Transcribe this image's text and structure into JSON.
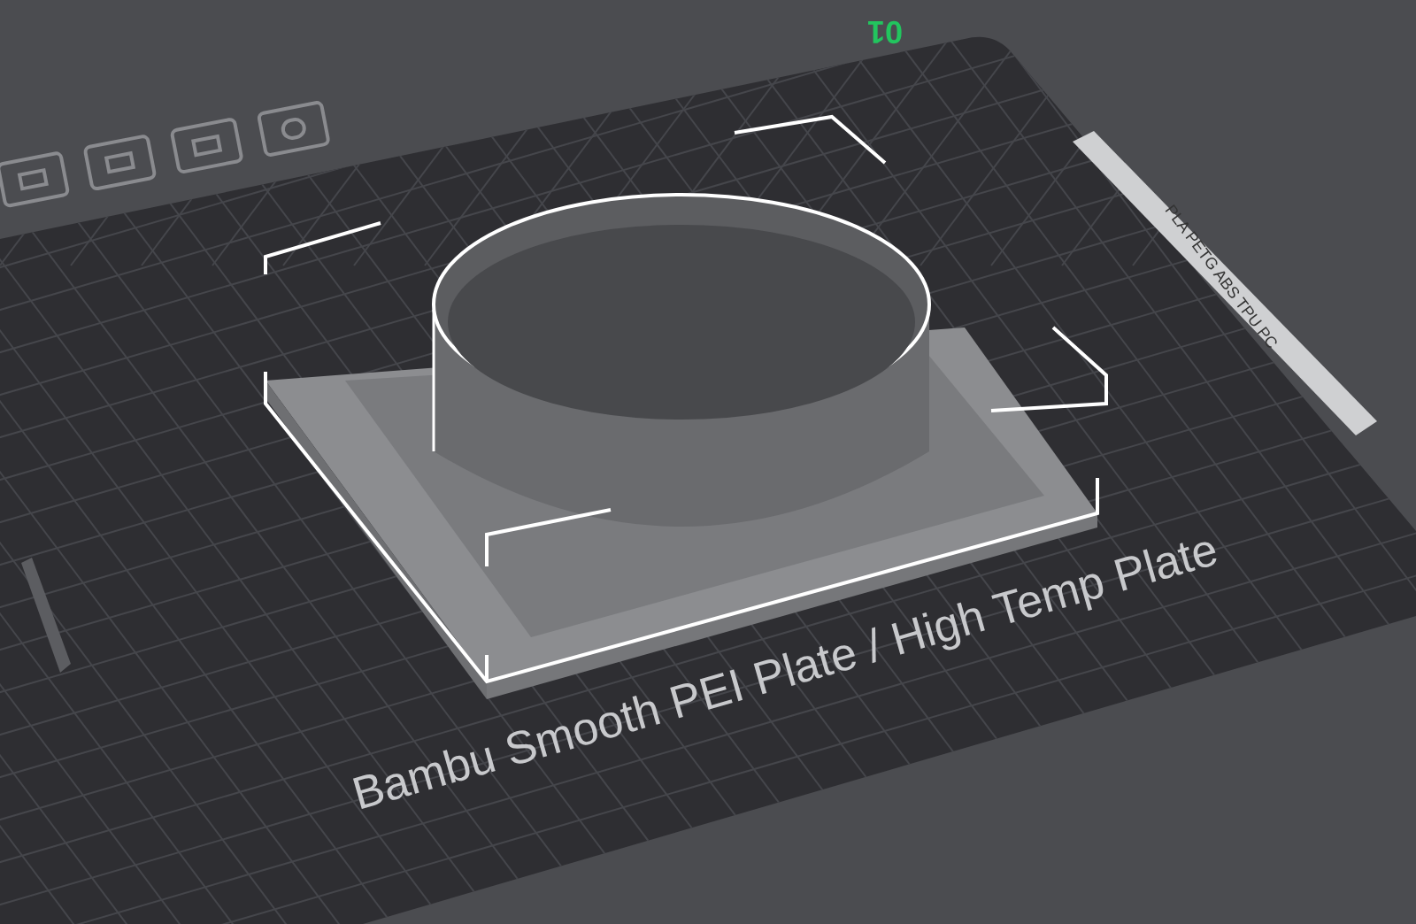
{
  "plate": {
    "number": "01",
    "label": "Bambu Smooth PEI Plate / High Temp Plate",
    "materials": "PLA PETG ABS TPU PC"
  }
}
